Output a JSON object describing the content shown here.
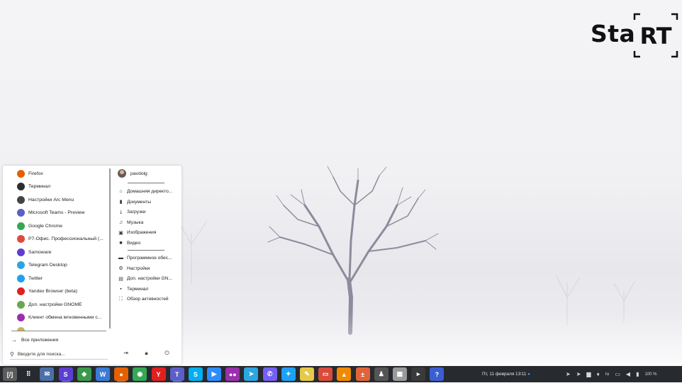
{
  "logo": {
    "text": "Sta",
    "framed_text": "RT"
  },
  "menu": {
    "apps": [
      {
        "label": "Firefox",
        "icon": "firefox-icon",
        "color": "#e66000"
      },
      {
        "label": "Терминал",
        "icon": "terminal-icon",
        "color": "#2e2e2e"
      },
      {
        "label": "Настройки Arc Menu",
        "icon": "arc-menu-icon",
        "color": "#444444"
      },
      {
        "label": "Microsoft Teams - Preview",
        "icon": "teams-icon",
        "color": "#5b5fc7"
      },
      {
        "label": "Google Chrome",
        "icon": "chrome-icon",
        "color": "#34a853"
      },
      {
        "label": "Р7-Офис. Профессиональный (...",
        "icon": "r7-office-icon",
        "color": "#e04a3a"
      },
      {
        "label": "Samoware",
        "icon": "samoware-icon",
        "color": "#5b3fd1"
      },
      {
        "label": "Telegram Desktop",
        "icon": "telegram-icon",
        "color": "#2ca5e0"
      },
      {
        "label": "Twitter",
        "icon": "twitter-icon",
        "color": "#1da1f2"
      },
      {
        "label": "Yandex Browser (beta)",
        "icon": "yandex-browser-icon",
        "color": "#e02020"
      },
      {
        "label": "Доп. настройки GNOME",
        "icon": "gnome-tweaks-icon",
        "color": "#6aa84f"
      },
      {
        "label": "Клиент обмена мгновенными с...",
        "icon": "messenger-icon",
        "color": "#9b2fae"
      },
      {
        "label": "...",
        "icon": "app-icon",
        "color": "#c9b35a"
      }
    ],
    "all_apps_label": "Все приложения",
    "search_placeholder": "Вводите для поиска...",
    "user": "pavdolg",
    "places": [
      {
        "label": "Домашняя директо...",
        "icon": "home-icon",
        "glyph": "⌂"
      },
      {
        "label": "Документы",
        "icon": "document-icon",
        "glyph": "▮"
      },
      {
        "label": "Загрузки",
        "icon": "download-icon",
        "glyph": "⤓"
      },
      {
        "label": "Музыка",
        "icon": "music-icon",
        "glyph": "♫"
      },
      {
        "label": "Изображения",
        "icon": "image-icon",
        "glyph": "▣"
      },
      {
        "label": "Видео",
        "icon": "video-icon",
        "glyph": "■"
      }
    ],
    "system": [
      {
        "label": "Программное обес...",
        "icon": "software-icon",
        "glyph": "▬"
      },
      {
        "label": "Настройки",
        "icon": "settings-icon",
        "glyph": "⚙"
      },
      {
        "label": "Доп. настройки GN...",
        "icon": "tweaks-icon",
        "glyph": "▤"
      },
      {
        "label": "Терминал",
        "icon": "terminal-icon",
        "glyph": "▪"
      },
      {
        "label": "Обзор активностей",
        "icon": "activities-icon",
        "glyph": "⛶"
      }
    ]
  },
  "taskbar": {
    "apps": [
      {
        "icon": "arc-menu-logo-icon",
        "color": "#5c5c5c",
        "glyph": "[/]",
        "running": false
      },
      {
        "icon": "app-grid-icon",
        "color": "#272a2e",
        "glyph": "⠿",
        "running": false
      },
      {
        "icon": "mail-icon",
        "color": "#4b6fa8",
        "glyph": "✉",
        "running": false
      },
      {
        "icon": "samoware-icon",
        "color": "#5b3fd1",
        "glyph": "S",
        "running": true
      },
      {
        "icon": "r7-office-icon",
        "color": "#3a9a4a",
        "glyph": "◆",
        "running": false
      },
      {
        "icon": "word-icon",
        "color": "#3a7bd5",
        "glyph": "W",
        "running": false
      },
      {
        "icon": "firefox-icon",
        "color": "#e66000",
        "glyph": "●",
        "running": true
      },
      {
        "icon": "chrome-icon",
        "color": "#34a853",
        "glyph": "◉",
        "running": false
      },
      {
        "icon": "yandex-browser-icon",
        "color": "#e02020",
        "glyph": "Y",
        "running": false
      },
      {
        "icon": "teams-icon",
        "color": "#5b5fc7",
        "glyph": "T",
        "running": true
      },
      {
        "icon": "skype-icon",
        "color": "#00aff0",
        "glyph": "S",
        "running": false
      },
      {
        "icon": "zoom-icon",
        "color": "#2d8cff",
        "glyph": "▶",
        "running": false
      },
      {
        "icon": "messenger-icon",
        "color": "#9b2fae",
        "glyph": "●●",
        "running": false
      },
      {
        "icon": "telegram-icon",
        "color": "#2ca5e0",
        "glyph": "➤",
        "running": false
      },
      {
        "icon": "viber-icon",
        "color": "#7360f2",
        "glyph": "✆",
        "running": false
      },
      {
        "icon": "twitter-icon",
        "color": "#1da1f2",
        "glyph": "✦",
        "running": false
      },
      {
        "icon": "paint-icon",
        "color": "#e6c84a",
        "glyph": "✎",
        "running": false
      },
      {
        "icon": "presentation-icon",
        "color": "#d94b3a",
        "glyph": "▭",
        "running": false
      },
      {
        "icon": "vlc-icon",
        "color": "#f08a00",
        "glyph": "▲",
        "running": false
      },
      {
        "icon": "calculator-icon",
        "color": "#e0643a",
        "glyph": "±",
        "running": false
      },
      {
        "icon": "user-icon",
        "color": "#555555",
        "glyph": "♟",
        "running": false
      },
      {
        "icon": "software-center-icon",
        "color": "#9a9a9a",
        "glyph": "▦",
        "running": false
      },
      {
        "icon": "terminal-icon",
        "color": "#3a3a3a",
        "glyph": "▸",
        "running": false
      },
      {
        "icon": "help-icon",
        "color": "#3a5fd1",
        "glyph": "?",
        "running": false
      }
    ],
    "clock": "Пт, 11 февраля  13∶11",
    "clock_indicator": "●",
    "tray": [
      {
        "icon": "telegram-tray-icon",
        "glyph": "➤"
      },
      {
        "icon": "telegram-tray-icon",
        "glyph": "➤"
      },
      {
        "icon": "chat-tray-icon",
        "glyph": "▆"
      },
      {
        "icon": "teams-tray-icon",
        "glyph": "♦"
      }
    ],
    "lang": "ru",
    "battery_pct": "100 %"
  }
}
